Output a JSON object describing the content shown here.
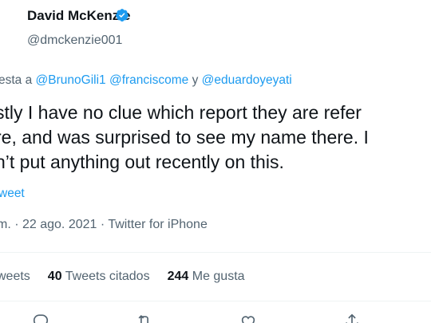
{
  "tweet": {
    "author_name": "David McKenzie",
    "author_handle": "@dmckenzie001",
    "reply_prefix": "esta a",
    "reply_mentions": [
      "@BrunoGili1",
      "@franciscome"
    ],
    "reply_conjunction": "y",
    "reply_last_mention": "@eduardoyeyati",
    "text_lines": [
      "stly I have no clue which report they are refer",
      "re, and was surprised to see my name there. I",
      "n’t put anything out recently on this."
    ],
    "translate_label": "weet",
    "meta": "m. · 22 ago. 2021 · Twitter for iPhone"
  },
  "stats": {
    "retweets_label": "weets",
    "quote_count": "40",
    "quote_label": "Tweets citados",
    "likes_count": "244",
    "likes_label": "Me gusta"
  },
  "colors": {
    "accent": "#1d9bf0",
    "secondary_text": "#536471",
    "primary_text": "#0f1419",
    "divider": "#eff3f4"
  },
  "icons": [
    "verified-badge-icon",
    "reply-icon",
    "retweet-icon",
    "like-icon",
    "share-icon"
  ]
}
